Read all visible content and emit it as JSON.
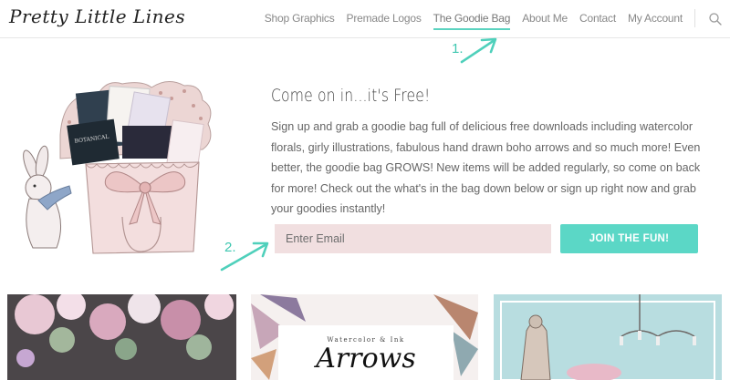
{
  "header": {
    "logo": "Pretty Little Lines",
    "nav": [
      {
        "label": "Shop Graphics"
      },
      {
        "label": "Premade Logos"
      },
      {
        "label": "The Goodie Bag"
      },
      {
        "label": "About Me"
      },
      {
        "label": "Contact"
      },
      {
        "label": "My Account"
      }
    ],
    "active_nav": "The Goodie Bag",
    "search_icon": "search-icon"
  },
  "annotations": {
    "step1": "1.",
    "step2": "2.",
    "color": "#3ec7b0"
  },
  "main": {
    "headline": "Come on in...it's Free!",
    "intro": "Sign up and grab a goodie bag full of delicious free downloads including watercolor florals, girly illustrations, fabulous hand drawn boho arrows and so much more!  Even better, the goodie bag GROWS!  New items will be added regularly, so come on back for more!  Check out the what's in the bag down below or sign up right now and grab your goodies instantly!",
    "email_placeholder": "Enter Email",
    "join_button": "JOIN THE FUN!"
  },
  "cards": [
    {
      "name": "watercolor-florals"
    },
    {
      "small_title": "Watercolor & Ink",
      "big_title": "Arrows"
    },
    {
      "name": "vintage-chandelier"
    }
  ],
  "colors": {
    "accent": "#5bd7c6",
    "input_bg": "#f1dfe0",
    "text": "#666666"
  }
}
